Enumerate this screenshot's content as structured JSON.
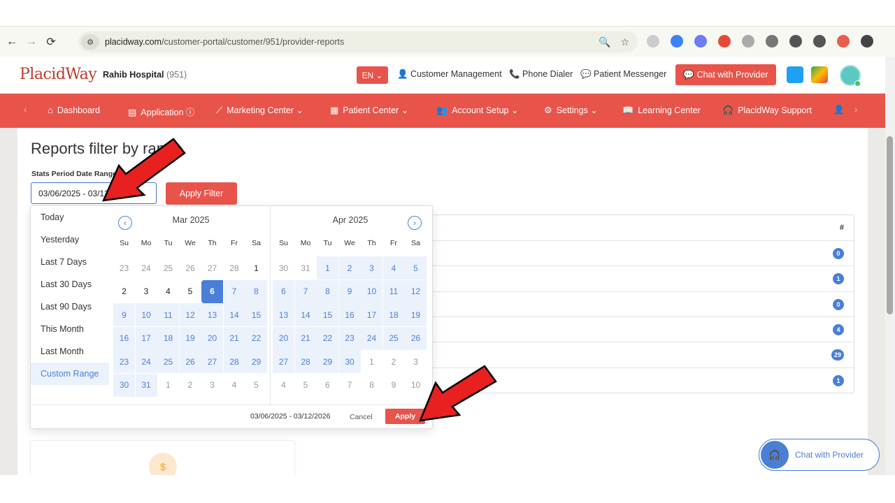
{
  "browser": {
    "url_domain": "placidway.com",
    "url_path": "/customer-portal/customer/951/provider-reports"
  },
  "header": {
    "logo": "PlacidWay",
    "hospital_name": "Rahib Hospital",
    "hospital_id": "(951)",
    "lang": "EN",
    "links": [
      "Customer Management",
      "Phone Dialer",
      "Patient Messenger"
    ],
    "chat_button": "Chat with Provider"
  },
  "nav": {
    "items": [
      "Dashboard",
      "Application",
      "Marketing Center",
      "Patient Center",
      "Account Setup",
      "Settings",
      "Learning Center",
      "PlacidWay Support"
    ]
  },
  "page": {
    "title": "Reports filter by range",
    "filter_label": "Stats Period Date Range",
    "date_value": "03/06/2025 - 03/12/2026",
    "apply_filter": "Apply Filter"
  },
  "stats": {
    "header": "#",
    "counts": [
      "0",
      "1",
      "0",
      "4",
      "29",
      "1"
    ]
  },
  "picker": {
    "ranges": [
      "Today",
      "Yesterday",
      "Last 7 Days",
      "Last 30 Days",
      "Last 90 Days",
      "This Month",
      "Last Month",
      "Custom Range"
    ],
    "active_range": "Custom Range",
    "weekdays": [
      "Su",
      "Mo",
      "Tu",
      "We",
      "Th",
      "Fr",
      "Sa"
    ],
    "left_month": "Mar 2025",
    "right_month": "Apr 2025",
    "left_days": [
      [
        "23",
        "24",
        "25",
        "26",
        "27",
        "28",
        "1"
      ],
      [
        "2",
        "3",
        "4",
        "5",
        "6",
        "7",
        "8"
      ],
      [
        "9",
        "10",
        "11",
        "12",
        "13",
        "14",
        "15"
      ],
      [
        "16",
        "17",
        "18",
        "19",
        "20",
        "21",
        "22"
      ],
      [
        "23",
        "24",
        "25",
        "26",
        "27",
        "28",
        "29"
      ],
      [
        "30",
        "31",
        "1",
        "2",
        "3",
        "4",
        "5"
      ]
    ],
    "right_days": [
      [
        "30",
        "31",
        "1",
        "2",
        "3",
        "4",
        "5"
      ],
      [
        "6",
        "7",
        "8",
        "9",
        "10",
        "11",
        "12"
      ],
      [
        "13",
        "14",
        "15",
        "16",
        "17",
        "18",
        "19"
      ],
      [
        "20",
        "21",
        "22",
        "23",
        "24",
        "25",
        "26"
      ],
      [
        "27",
        "28",
        "29",
        "30",
        "1",
        "2",
        "3"
      ],
      [
        "4",
        "5",
        "6",
        "7",
        "8",
        "9",
        "10"
      ]
    ],
    "footer_range": "03/06/2025 - 03/12/2026",
    "cancel": "Cancel",
    "apply": "Apply"
  },
  "chat_float": "Chat with Provider",
  "colors": {
    "brand": "#e8544a",
    "accent": "#4a7fd8"
  }
}
